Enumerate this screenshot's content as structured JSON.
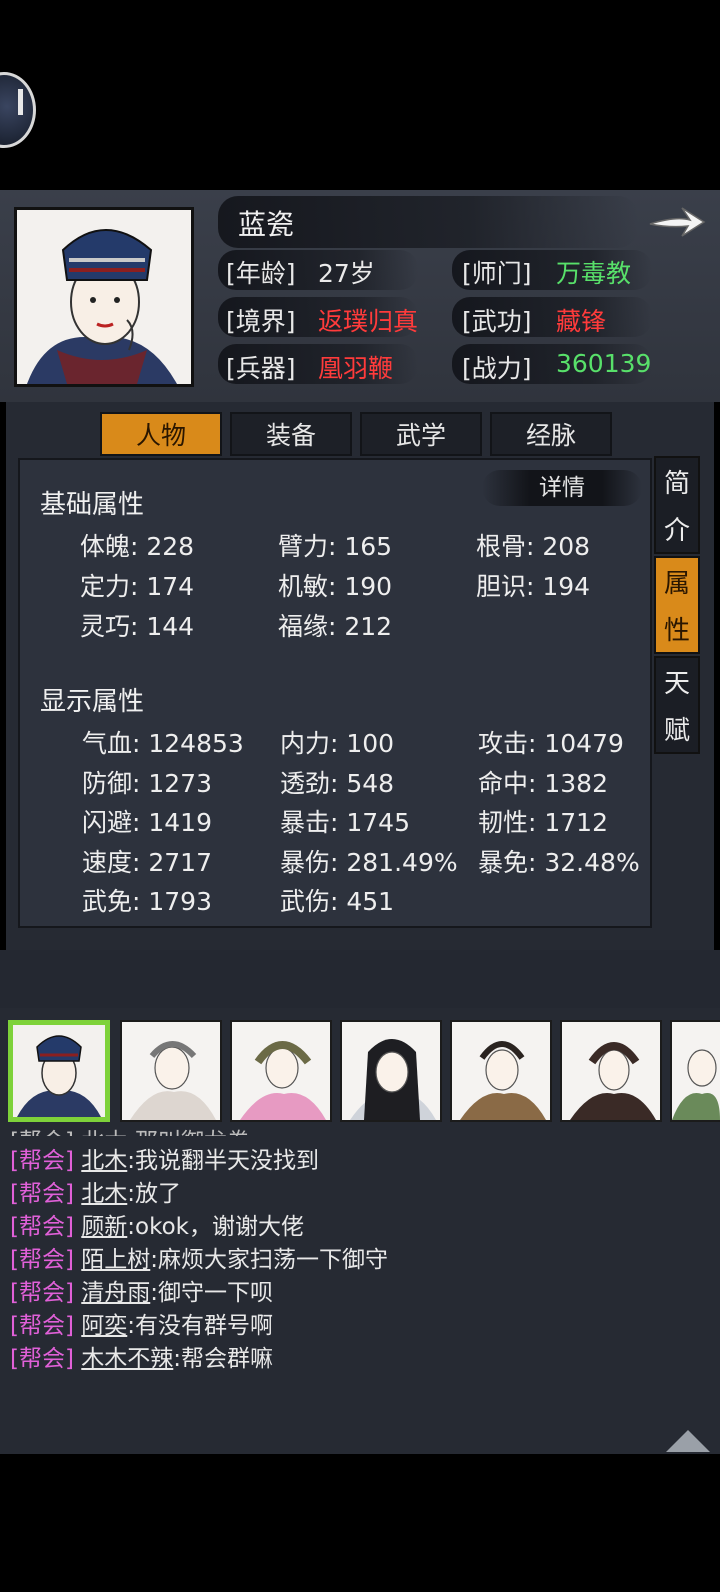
{
  "character": {
    "name": "蓝瓷",
    "info": [
      {
        "label": "[年龄]",
        "value": "27岁"
      },
      {
        "label": "[师门]",
        "value": "万毒教"
      },
      {
        "label": "[境界]",
        "value": "返璞归真"
      },
      {
        "label": "[武功]",
        "value": "藏锋"
      },
      {
        "label": "[兵器]",
        "value": "凰羽鞭"
      },
      {
        "label": "[战力]",
        "value": "360139"
      }
    ]
  },
  "tabs": [
    "人物",
    "装备",
    "武学",
    "经脉"
  ],
  "side_tabs": [
    {
      "chars": [
        "简",
        "介"
      ]
    },
    {
      "chars": [
        "属",
        "性"
      ]
    },
    {
      "chars": [
        "天",
        "赋"
      ]
    }
  ],
  "detail_label": "详情",
  "basic": {
    "title": "基础属性",
    "stats": [
      "体魄: 228",
      "臂力: 165",
      "根骨: 208",
      "定力: 174",
      "机敏: 190",
      "胆识: 194",
      "灵巧: 144",
      "福缘: 212"
    ]
  },
  "display": {
    "title": "显示属性",
    "stats": [
      "气血: 124853",
      "内力: 100",
      "攻击: 10479",
      "防御: 1273",
      "透劲: 548",
      "命中: 1382",
      "闪避: 1419",
      "暴击: 1745",
      "韧性: 1712",
      "速度: 2717",
      "暴伤: 281.49%",
      "暴免: 32.48%",
      "武免: 1793",
      "武伤: 451"
    ]
  },
  "chat": {
    "partial": "[帮会] 北木:那叫御龙拳",
    "lines": [
      {
        "tag": "[帮会]",
        "name": "北木",
        "msg": ":我说翻半天没找到"
      },
      {
        "tag": "[帮会]",
        "name": "北木",
        "msg": ":放了"
      },
      {
        "tag": "[帮会]",
        "name": "顾新",
        "msg": ":okok，谢谢大佬"
      },
      {
        "tag": "[帮会]",
        "name": "陌上树",
        "msg": ":麻烦大家扫荡一下御守"
      },
      {
        "tag": "[帮会]",
        "name": "清舟雨",
        "msg": ":御守一下呗"
      },
      {
        "tag": "[帮会]",
        "name": "阿奕",
        "msg": ":有没有群号啊"
      },
      {
        "tag": "[帮会]",
        "name": "木木不辣",
        "msg": ":帮会群嘛"
      }
    ]
  },
  "colors": {
    "accent_orange": "#d98a1a",
    "value_red": "#ff3b3b",
    "value_green": "#58e06a",
    "chat_tag": "#e060d8",
    "selected_border": "#7ed23a"
  },
  "icons": {
    "corner": "menu-round-button-icon",
    "next": "arrow-right-icon",
    "scroll": "triangle-up-icon"
  }
}
